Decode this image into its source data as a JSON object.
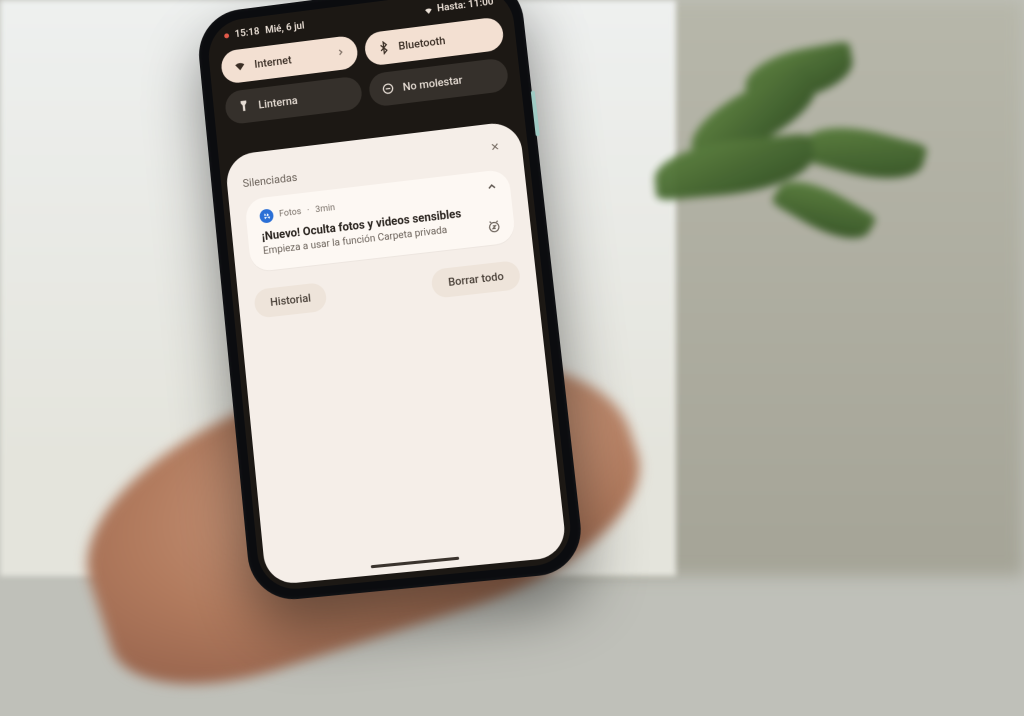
{
  "status": {
    "time": "15:18",
    "date": "Mié, 6 jul",
    "right_label": "Hasta: 11:00"
  },
  "tiles": {
    "internet": "Internet",
    "bluetooth": "Bluetooth",
    "flashlight": "Linterna",
    "dnd": "No molestar"
  },
  "panel": {
    "silenced_header": "Silenciadas",
    "notif": {
      "app": "Fotos",
      "sep": " · ",
      "age": "3min",
      "title": "¡Nuevo! Oculta fotos y videos sensibles",
      "body": "Empieza a usar la función Carpeta privada"
    },
    "history_label": "Historial",
    "clear_label": "Borrar todo"
  }
}
